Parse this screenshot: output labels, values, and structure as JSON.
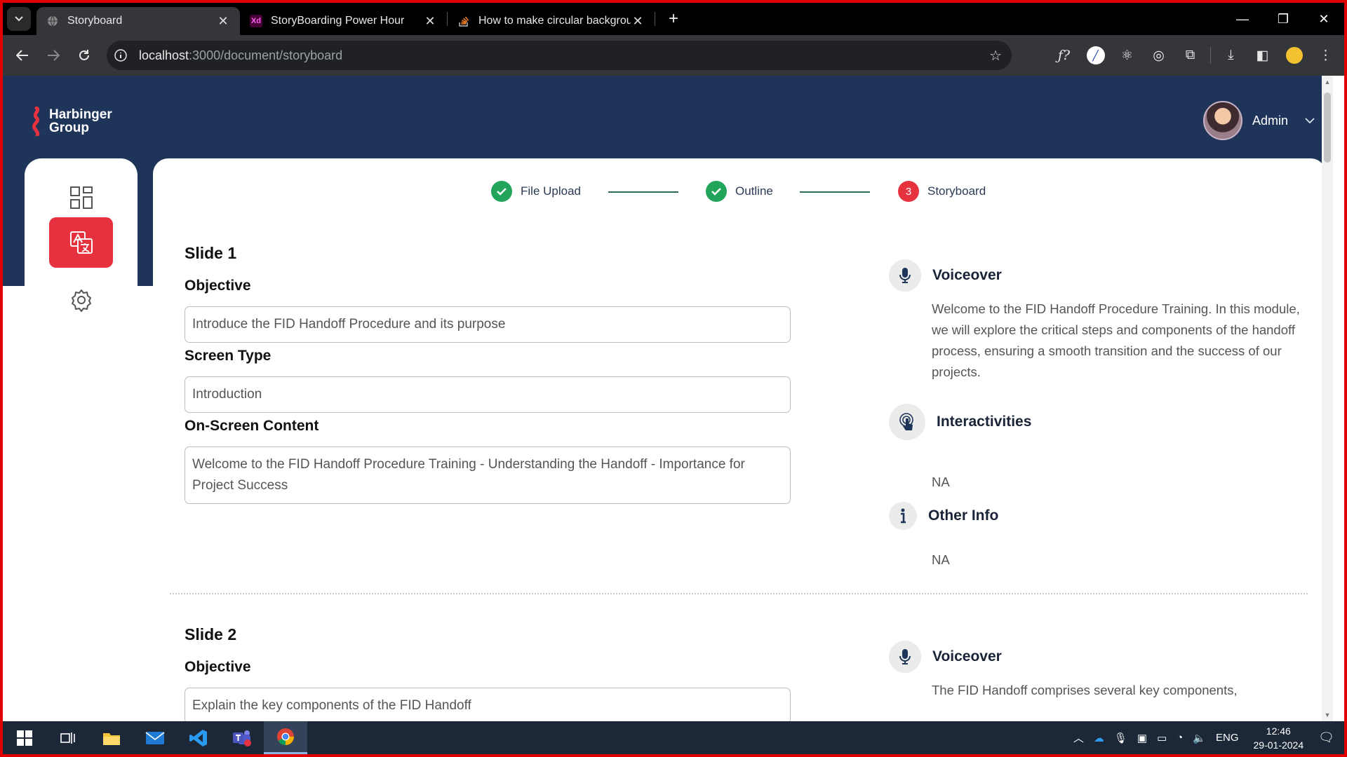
{
  "browser": {
    "tabs": [
      {
        "title": "Storyboard",
        "active": true,
        "favicon": "globe-icon"
      },
      {
        "title": "StoryBoarding Power Hour",
        "active": false,
        "favicon": "xd-icon"
      },
      {
        "title": "How to make circular backgrou",
        "active": false,
        "favicon": "stackoverflow-icon"
      }
    ],
    "address": {
      "host": "localhost",
      "rest": ":3000/document/storyboard"
    }
  },
  "app": {
    "logo": {
      "line1": "Harbinger",
      "line2": "Group"
    },
    "user": {
      "name": "Admin"
    },
    "sidebar": {
      "items": [
        {
          "name": "dashboard",
          "icon": "grid-icon",
          "active": false
        },
        {
          "name": "translate",
          "icon": "translate-icon",
          "active": true
        },
        {
          "name": "settings",
          "icon": "gear-icon",
          "active": false
        }
      ]
    },
    "stepper": {
      "steps": [
        {
          "label": "File Upload",
          "state": "done"
        },
        {
          "label": "Outline",
          "state": "done"
        },
        {
          "label": "Storyboard",
          "state": "current",
          "number": "3"
        }
      ]
    },
    "slides": [
      {
        "title": "Slide 1",
        "objective_label": "Objective",
        "objective": "Introduce the FID Handoff Procedure and its purpose",
        "screen_type_label": "Screen Type",
        "screen_type": "Introduction",
        "content_label": "On-Screen Content",
        "content": "Welcome to the FID Handoff Procedure Training - Understanding the Handoff - Importance for Project Success",
        "voiceover_label": "Voiceover",
        "voiceover": "Welcome to the FID Handoff Procedure Training. In this module, we will explore the critical steps and components of the handoff process, ensuring a smooth transition and the success of our projects.",
        "interactivities_label": "Interactivities",
        "interactivities": "NA",
        "other_info_label": "Other Info",
        "other_info": "NA"
      },
      {
        "title": "Slide 2",
        "objective_label": "Objective",
        "objective": "Explain the key components of the FID Handoff",
        "voiceover_label": "Voiceover",
        "voiceover": "The FID Handoff comprises several key components,"
      }
    ]
  },
  "taskbar": {
    "language": "ENG",
    "time": "12:46",
    "date": "29-01-2024"
  },
  "colors": {
    "brand_navy": "#1e3559",
    "accent_red": "#e5323e",
    "step_done": "#22a55b"
  }
}
